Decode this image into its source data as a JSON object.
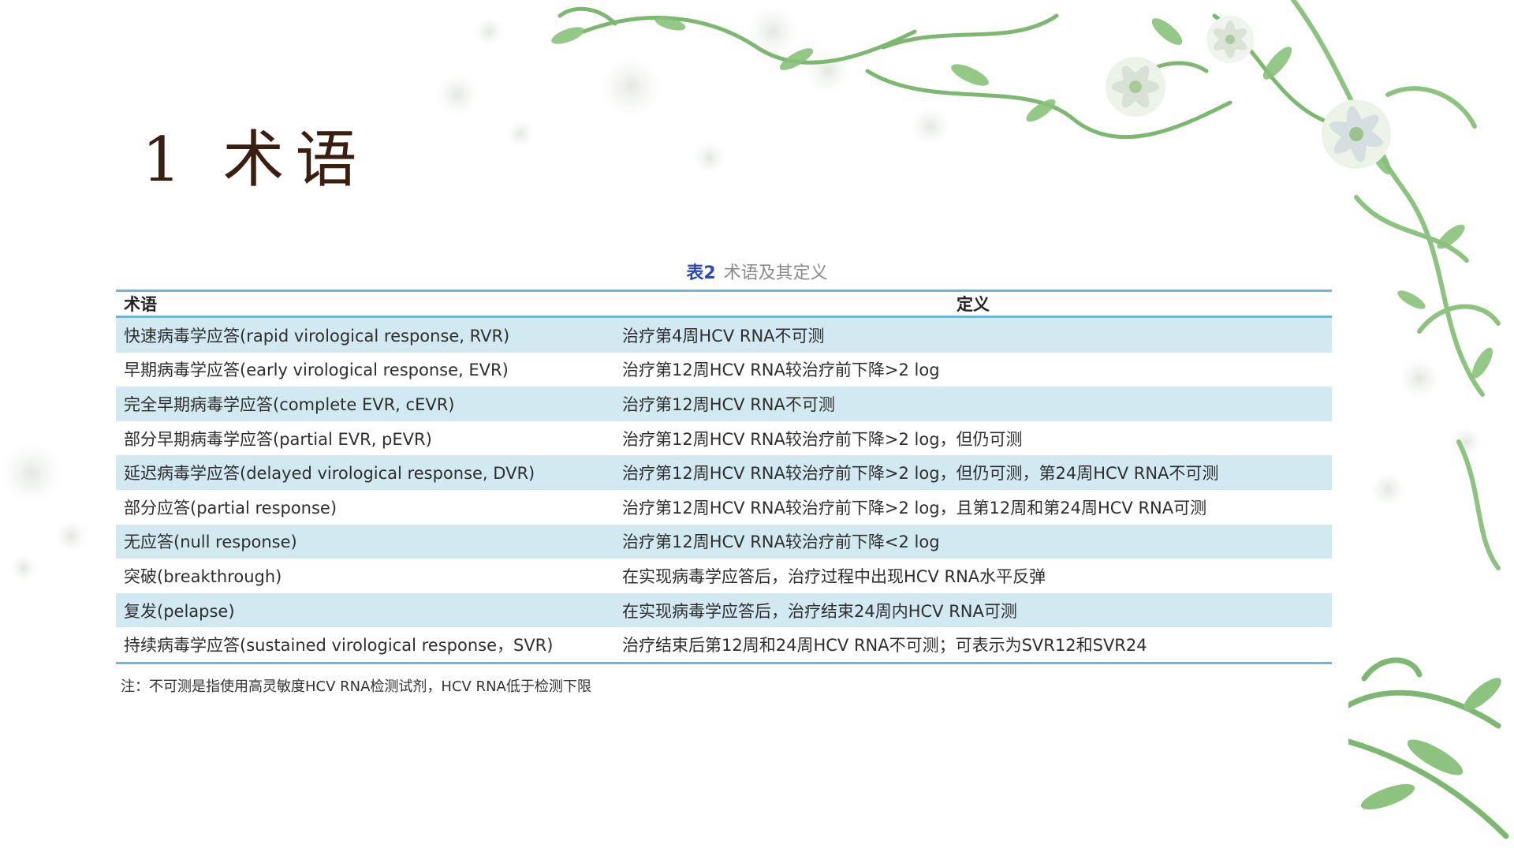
{
  "slide": {
    "title": "1 术语"
  },
  "table": {
    "caption_number": "表2",
    "caption_text": "术语及其定义",
    "headers": [
      "术语",
      "定义"
    ],
    "rows": [
      [
        "快速病毒学应答(rapid virological response, RVR)",
        "治疗第4周HCV RNA不可测"
      ],
      [
        "早期病毒学应答(early virological response, EVR)",
        "治疗第12周HCV RNA较治疗前下降>2 log"
      ],
      [
        "完全早期病毒学应答(complete EVR, cEVR)",
        "治疗第12周HCV RNA不可测"
      ],
      [
        "部分早期病毒学应答(partial EVR, pEVR)",
        "治疗第12周HCV RNA较治疗前下降>2 log，但仍可测"
      ],
      [
        "延迟病毒学应答(delayed virological response, DVR)",
        "治疗第12周HCV RNA较治疗前下降>2 log，但仍可测，第24周HCV RNA不可测"
      ],
      [
        "部分应答(partial response)",
        "治疗第12周HCV RNA较治疗前下降>2 log，且第12周和第24周HCV RNA可测"
      ],
      [
        "无应答(null response)",
        "治疗第12周HCV RNA较治疗前下降<2 log"
      ],
      [
        "突破(breakthrough)",
        "在实现病毒学应答后，治疗过程中出现HCV RNA水平反弹"
      ],
      [
        "复发(pelapse)",
        "在实现病毒学应答后，治疗结束24周内HCV RNA可测"
      ],
      [
        "持续病毒学应答(sustained virological response，SVR)",
        "治疗结束后第12周和24周HCV RNA不可测；可表示为SVR12和SVR24"
      ]
    ],
    "footnote": "注：不可测是指使用高灵敏度HCV RNA检测试剂，HCV RNA低于检测下限"
  },
  "colors": {
    "accent_line": "#6fb6d8",
    "row_shade": "#d2e9f2",
    "caption_number": "#2d48b8",
    "title": "#3a1f10",
    "vine": "#7cb870"
  }
}
